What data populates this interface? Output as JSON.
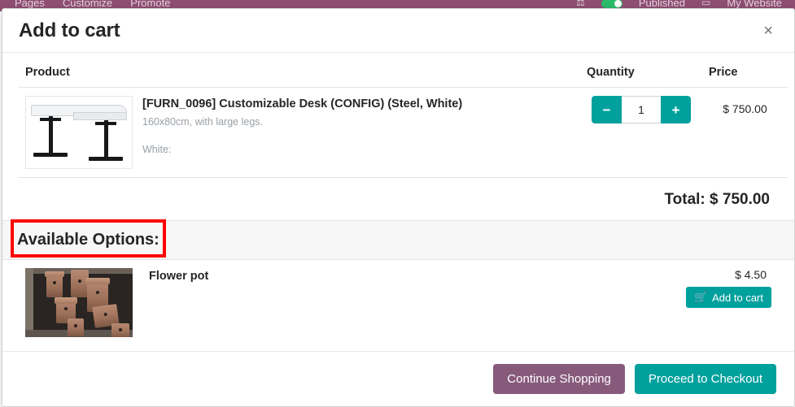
{
  "editor_bar": {
    "menu_left": [
      "Pages",
      "Customize",
      "Promote"
    ],
    "menu_right_label_published": "Published",
    "menu_right_label_website": "My Website",
    "icon_left": "ab-test-icon",
    "icon_mobile": "mobile-preview-icon"
  },
  "modal": {
    "title": "Add to cart",
    "close_label": "×"
  },
  "table": {
    "headers": {
      "product": "Product",
      "quantity": "Quantity",
      "price": "Price"
    },
    "rows": [
      {
        "name": "[FURN_0096] Customizable Desk (CONFIG) (Steel, White)",
        "description": "160x80cm, with large legs.",
        "attribute": "White:",
        "quantity": "1",
        "minus_label": "−",
        "plus_label": "+",
        "price": "$ 750.00",
        "thumb": "desk-image"
      }
    ],
    "total_label": "Total: $ 750.00"
  },
  "options": {
    "section_title": "Available Options:",
    "items": [
      {
        "name": "Flower pot",
        "price": "$ 4.50",
        "add_label": "Add to cart",
        "cart_icon": "shopping-cart-icon",
        "thumb": "flower-pot-image"
      }
    ]
  },
  "footer": {
    "continue_label": "Continue Shopping",
    "checkout_label": "Proceed to Checkout"
  },
  "colors": {
    "teal": "#00a09d",
    "purple": "#875a7b",
    "annotation_red": "#ff0000",
    "editor_bar": "#8f4f72"
  }
}
